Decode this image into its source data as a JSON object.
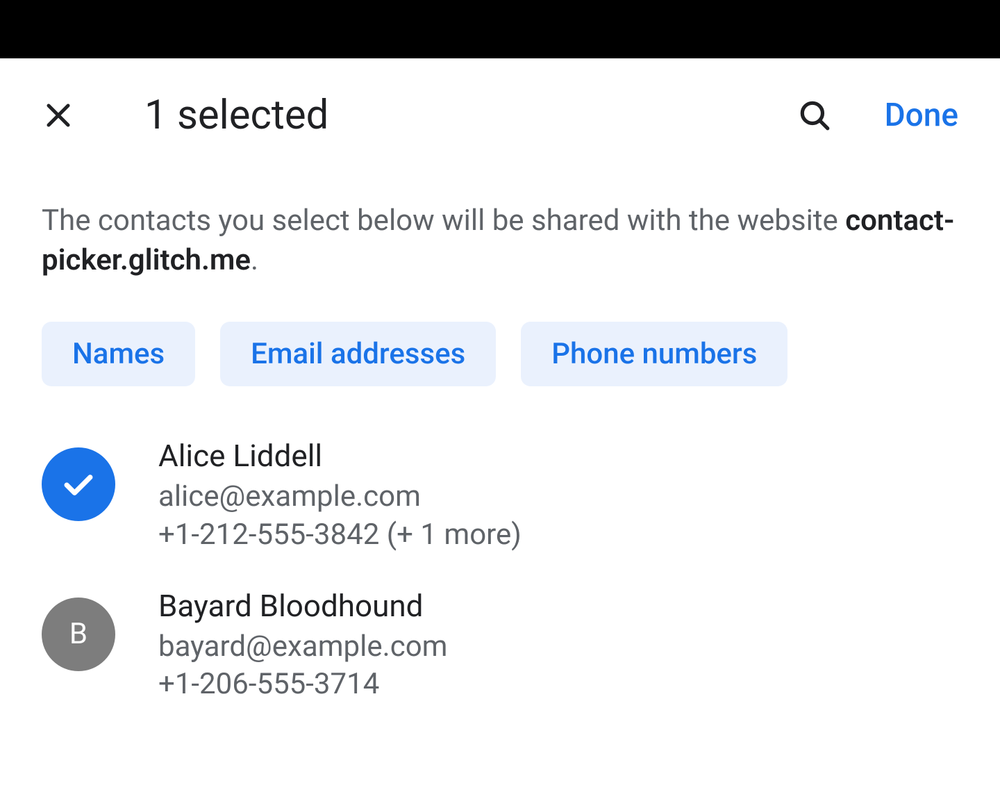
{
  "header": {
    "title": "1 selected",
    "done_label": "Done"
  },
  "description": {
    "prefix": "The contacts you select below will be shared with the website ",
    "website": "contact-picker.glitch.me",
    "suffix": "."
  },
  "chips": [
    {
      "label": "Names"
    },
    {
      "label": "Email addresses"
    },
    {
      "label": "Phone numbers"
    }
  ],
  "contacts": [
    {
      "selected": true,
      "initial": "",
      "name": "Alice Liddell",
      "email": "alice@example.com",
      "phone": "+1-212-555-3842 (+ 1 more)"
    },
    {
      "selected": false,
      "initial": "B",
      "name": "Bayard Bloodhound",
      "email": "bayard@example.com",
      "phone": "+1-206-555-3714"
    }
  ],
  "colors": {
    "accent": "#1a73e8",
    "text": "#202124",
    "muted": "#5f6368",
    "chip_bg": "#eaf1fd",
    "avatar_gray": "#7d7d7d"
  }
}
